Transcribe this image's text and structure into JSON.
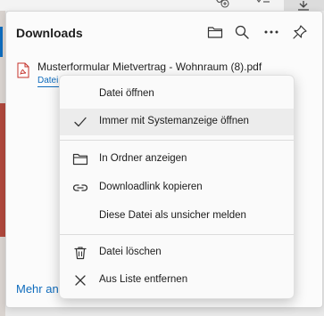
{
  "panel": {
    "title": "Downloads",
    "more_link": "Mehr anzeigen"
  },
  "file": {
    "name": "Musterformular Mietvertrag - Wohnraum (8).pdf",
    "sub_link": "Datei öffnen"
  },
  "menu": {
    "items": [
      {
        "label": "Datei öffnen",
        "icon": "none"
      },
      {
        "label": "Immer mit Systemanzeige öffnen",
        "icon": "checkmark-icon"
      },
      {
        "label": "In Ordner anzeigen",
        "icon": "folder-icon"
      },
      {
        "label": "Downloadlink kopieren",
        "icon": "link-icon"
      },
      {
        "label": "Diese Datei als unsicher melden",
        "icon": "none"
      },
      {
        "label": "Datei löschen",
        "icon": "trash-icon"
      },
      {
        "label": "Aus Liste entfernen",
        "icon": "close-icon"
      }
    ]
  },
  "colors": {
    "accent": "#0f6cbd",
    "pdf_red": "#c4312a",
    "menu_highlight": "#ececec"
  }
}
